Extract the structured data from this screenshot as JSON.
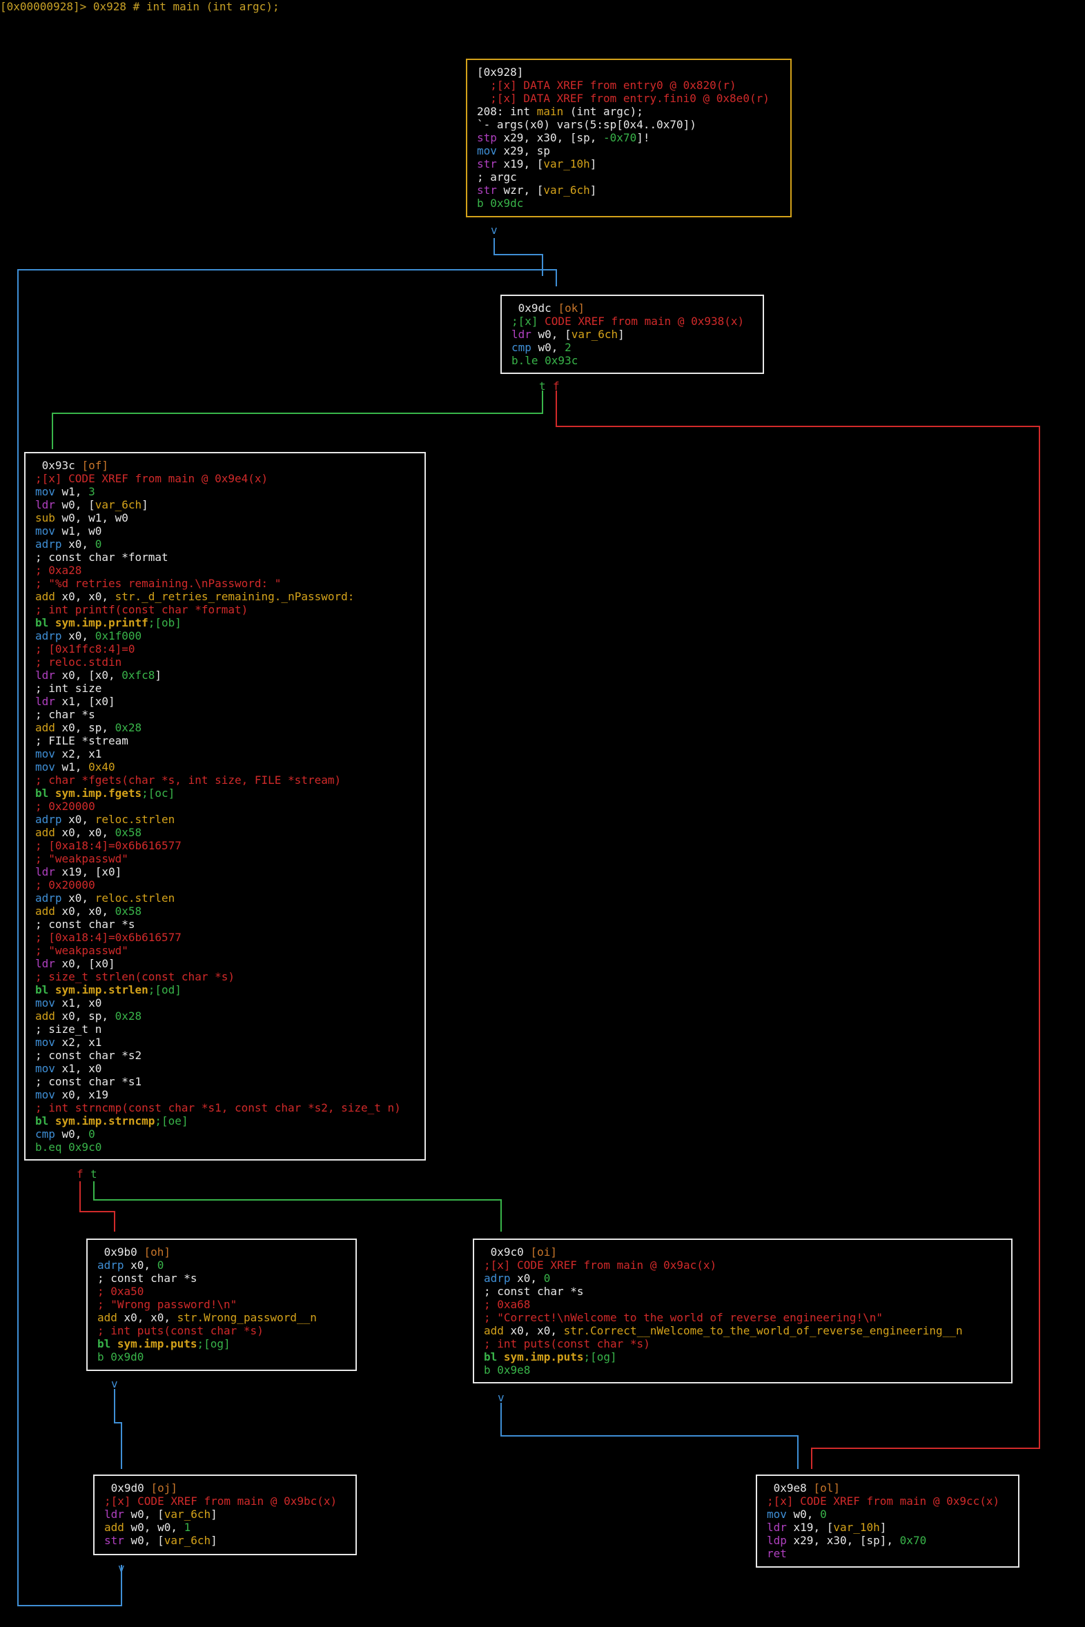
{
  "header": "[0x00000928]> 0x928 # int main (int argc);",
  "colors": {
    "white": "#e8e8e8",
    "red": "#d12a2a",
    "green": "#39b54a",
    "yellow": "#d4a21a",
    "blue": "#3f8fd6",
    "magenta": "#b040c0",
    "gray": "#bbbbbb"
  },
  "edge_labels": {
    "v": "v",
    "t": "t",
    "f": "f"
  },
  "blocks": [
    {
      "id": "b928",
      "lines": [
        [
          [
            "[0x928]",
            "w"
          ]
        ],
        [
          [
            "  ;[x] DATA XREF from entry0 @ 0x820(r)",
            "r"
          ]
        ],
        [
          [
            "  ;[x] DATA XREF from entry.fini0 @ 0x8e0(r)",
            "r"
          ]
        ],
        [
          [
            "208: int ",
            "w"
          ],
          [
            "main",
            "y"
          ],
          [
            " (int argc);",
            "w"
          ]
        ],
        [
          [
            "`- args(x0) vars(5:sp[0x4..0x70])",
            "w"
          ]
        ],
        [
          [
            "stp",
            "m"
          ],
          [
            " x29, x30, [sp, ",
            "w"
          ],
          [
            "-0x70",
            "g"
          ],
          [
            "]!",
            "w"
          ]
        ],
        [
          [
            "mov",
            "b"
          ],
          [
            " x29, sp",
            "w"
          ]
        ],
        [
          [
            "str",
            "m"
          ],
          [
            " x19, [",
            "w"
          ],
          [
            "var_10h",
            "y"
          ],
          [
            "]",
            "w"
          ]
        ],
        [
          [
            "; argc",
            "w"
          ]
        ],
        [
          [
            "str",
            "m"
          ],
          [
            " wzr, [",
            "w"
          ],
          [
            "var_6ch",
            "y"
          ],
          [
            "]",
            "w"
          ]
        ],
        [
          [
            "b 0x9dc",
            "g"
          ]
        ]
      ]
    },
    {
      "id": "b9dc",
      "lines": [
        [
          [
            " 0x9dc ",
            "w"
          ],
          [
            "[ok]",
            "o"
          ]
        ],
        [
          [
            ";[x]",
            "g"
          ],
          [
            " CODE XREF from main @ 0x938(x)",
            "r"
          ]
        ],
        [
          [
            "ldr",
            "m"
          ],
          [
            " w0, [",
            "w"
          ],
          [
            "var_6ch",
            "y"
          ],
          [
            "]",
            "w"
          ]
        ],
        [
          [
            "cmp",
            "b"
          ],
          [
            " w0, ",
            "w"
          ],
          [
            "2",
            "g"
          ]
        ],
        [
          [
            "b.le 0x93c",
            "g"
          ]
        ]
      ]
    },
    {
      "id": "b93c",
      "lines": [
        [
          [
            " 0x93c ",
            "w"
          ],
          [
            "[of]",
            "o"
          ]
        ],
        [
          [
            ";[x] CODE XREF from main @ 0x9e4(x)",
            "r"
          ]
        ],
        [
          [
            "mov",
            "b"
          ],
          [
            " w1, ",
            "w"
          ],
          [
            "3",
            "g"
          ]
        ],
        [
          [
            "ldr",
            "m"
          ],
          [
            " w0, [",
            "w"
          ],
          [
            "var_6ch",
            "y"
          ],
          [
            "]",
            "w"
          ]
        ],
        [
          [
            "sub",
            "y"
          ],
          [
            " w0, w1, w0",
            "w"
          ]
        ],
        [
          [
            "mov",
            "b"
          ],
          [
            " w1, w0",
            "w"
          ]
        ],
        [
          [
            "adrp",
            "b"
          ],
          [
            " x0, ",
            "w"
          ],
          [
            "0",
            "g"
          ]
        ],
        [
          [
            "; const char *format",
            "w"
          ]
        ],
        [
          [
            "; 0xa28",
            "r"
          ]
        ],
        [
          [
            "; \"%d retries remaining.\\nPassword: \"",
            "r"
          ]
        ],
        [
          [
            "add",
            "y"
          ],
          [
            " x0, x0, ",
            "w"
          ],
          [
            "str._d_retries_remaining._nPassword:",
            "y"
          ]
        ],
        [
          [
            "; int printf(const char *format)",
            "r"
          ]
        ],
        [
          [
            "bl ",
            "G"
          ],
          [
            "sym.imp.printf",
            "Y"
          ],
          [
            ";[ob]",
            "g"
          ]
        ],
        [
          [
            "adrp",
            "b"
          ],
          [
            " x0, ",
            "w"
          ],
          [
            "0x1f000",
            "g"
          ]
        ],
        [
          [
            "; [0x1ffc8:4]=0",
            "r"
          ]
        ],
        [
          [
            "; reloc.stdin",
            "r"
          ]
        ],
        [
          [
            "ldr",
            "m"
          ],
          [
            " x0, [x0, ",
            "w"
          ],
          [
            "0xfc8",
            "g"
          ],
          [
            "]",
            "w"
          ]
        ],
        [
          [
            "; int size",
            "w"
          ]
        ],
        [
          [
            "ldr",
            "m"
          ],
          [
            " x1, [x0]",
            "w"
          ]
        ],
        [
          [
            "; char *s",
            "w"
          ]
        ],
        [
          [
            "add",
            "y"
          ],
          [
            " x0, sp, ",
            "w"
          ],
          [
            "0x28",
            "g"
          ]
        ],
        [
          [
            "; FILE *stream",
            "w"
          ]
        ],
        [
          [
            "mov",
            "b"
          ],
          [
            " x2, x1",
            "w"
          ]
        ],
        [
          [
            "mov",
            "b"
          ],
          [
            " w1, ",
            "w"
          ],
          [
            "0x40",
            "y"
          ]
        ],
        [
          [
            "; char *fgets(char *s, int size, FILE *stream)",
            "r"
          ]
        ],
        [
          [
            "bl ",
            "G"
          ],
          [
            "sym.imp.fgets",
            "Y"
          ],
          [
            ";[oc]",
            "g"
          ]
        ],
        [
          [
            "; 0x20000",
            "r"
          ]
        ],
        [
          [
            "adrp",
            "b"
          ],
          [
            " x0, ",
            "w"
          ],
          [
            "reloc.strlen",
            "y"
          ]
        ],
        [
          [
            "add",
            "y"
          ],
          [
            " x0, x0, ",
            "w"
          ],
          [
            "0x58",
            "g"
          ]
        ],
        [
          [
            "; [0xa18:4]=0x6b616577",
            "r"
          ]
        ],
        [
          [
            "; \"weakpasswd\"",
            "r"
          ]
        ],
        [
          [
            "ldr",
            "m"
          ],
          [
            " x19, [x0]",
            "w"
          ]
        ],
        [
          [
            "; 0x20000",
            "r"
          ]
        ],
        [
          [
            "adrp",
            "b"
          ],
          [
            " x0, ",
            "w"
          ],
          [
            "reloc.strlen",
            "y"
          ]
        ],
        [
          [
            "add",
            "y"
          ],
          [
            " x0, x0, ",
            "w"
          ],
          [
            "0x58",
            "g"
          ]
        ],
        [
          [
            "; const char *s",
            "w"
          ]
        ],
        [
          [
            "; [0xa18:4]=0x6b616577",
            "r"
          ]
        ],
        [
          [
            "; \"weakpasswd\"",
            "r"
          ]
        ],
        [
          [
            "ldr",
            "m"
          ],
          [
            " x0, [x0]",
            "w"
          ]
        ],
        [
          [
            "; size_t strlen(const char *s)",
            "r"
          ]
        ],
        [
          [
            "bl ",
            "G"
          ],
          [
            "sym.imp.strlen",
            "Y"
          ],
          [
            ";[od]",
            "g"
          ]
        ],
        [
          [
            "mov",
            "b"
          ],
          [
            " x1, x0",
            "w"
          ]
        ],
        [
          [
            "add",
            "y"
          ],
          [
            " x0, sp, ",
            "w"
          ],
          [
            "0x28",
            "g"
          ]
        ],
        [
          [
            "; size_t n",
            "w"
          ]
        ],
        [
          [
            "mov",
            "b"
          ],
          [
            " x2, x1",
            "w"
          ]
        ],
        [
          [
            "; const char *s2",
            "w"
          ]
        ],
        [
          [
            "mov",
            "b"
          ],
          [
            " x1, x0",
            "w"
          ]
        ],
        [
          [
            "; const char *s1",
            "w"
          ]
        ],
        [
          [
            "mov",
            "b"
          ],
          [
            " x0, x19",
            "w"
          ]
        ],
        [
          [
            "; int strncmp(const char *s1, const char *s2, size_t n)",
            "r"
          ]
        ],
        [
          [
            "bl ",
            "G"
          ],
          [
            "sym.imp.strncmp",
            "Y"
          ],
          [
            ";[oe]",
            "g"
          ]
        ],
        [
          [
            "cmp",
            "b"
          ],
          [
            " w0, ",
            "w"
          ],
          [
            "0",
            "g"
          ]
        ],
        [
          [
            "b.eq 0x9c0",
            "g"
          ]
        ]
      ]
    },
    {
      "id": "b9b0",
      "lines": [
        [
          [
            " 0x9b0 ",
            "w"
          ],
          [
            "[oh]",
            "o"
          ]
        ],
        [
          [
            "adrp",
            "b"
          ],
          [
            " x0, ",
            "w"
          ],
          [
            "0",
            "g"
          ]
        ],
        [
          [
            "; const char *s",
            "w"
          ]
        ],
        [
          [
            "; 0xa50",
            "r"
          ]
        ],
        [
          [
            "; \"Wrong password!\\n\"",
            "r"
          ]
        ],
        [
          [
            "add",
            "y"
          ],
          [
            " x0, x0, ",
            "w"
          ],
          [
            "str.Wrong_password__n",
            "y"
          ]
        ],
        [
          [
            "; int puts(const char *s)",
            "r"
          ]
        ],
        [
          [
            "bl ",
            "G"
          ],
          [
            "sym.imp.puts",
            "Y"
          ],
          [
            ";[og]",
            "g"
          ]
        ],
        [
          [
            "b 0x9d0",
            "g"
          ]
        ]
      ]
    },
    {
      "id": "b9c0",
      "lines": [
        [
          [
            " 0x9c0 ",
            "w"
          ],
          [
            "[oi]",
            "o"
          ]
        ],
        [
          [
            ";[x] CODE XREF from main @ 0x9ac(x)",
            "r"
          ]
        ],
        [
          [
            "adrp",
            "b"
          ],
          [
            " x0, ",
            "w"
          ],
          [
            "0",
            "g"
          ]
        ],
        [
          [
            "; const char *s",
            "w"
          ]
        ],
        [
          [
            "; 0xa68",
            "r"
          ]
        ],
        [
          [
            "; \"Correct!\\nWelcome to the world of reverse engineering!\\n\"",
            "r"
          ]
        ],
        [
          [
            "add",
            "y"
          ],
          [
            " x0, x0, ",
            "w"
          ],
          [
            "str.Correct__nWelcome_to_the_world_of_reverse_engineering__n",
            "y"
          ]
        ],
        [
          [
            "; int puts(const char *s)",
            "r"
          ]
        ],
        [
          [
            "bl ",
            "G"
          ],
          [
            "sym.imp.puts",
            "Y"
          ],
          [
            ";[og]",
            "g"
          ]
        ],
        [
          [
            "b 0x9e8",
            "g"
          ]
        ]
      ]
    },
    {
      "id": "b9d0",
      "lines": [
        [
          [
            " 0x9d0 ",
            "w"
          ],
          [
            "[oj]",
            "o"
          ]
        ],
        [
          [
            ";[x] CODE XREF from main @ 0x9bc(x)",
            "r"
          ]
        ],
        [
          [
            "ldr",
            "m"
          ],
          [
            " w0, [",
            "w"
          ],
          [
            "var_6ch",
            "y"
          ],
          [
            "]",
            "w"
          ]
        ],
        [
          [
            "add",
            "y"
          ],
          [
            " w0, w0, ",
            "w"
          ],
          [
            "1",
            "g"
          ]
        ],
        [
          [
            "str",
            "m"
          ],
          [
            " w0, [",
            "w"
          ],
          [
            "var_6ch",
            "y"
          ],
          [
            "]",
            "w"
          ]
        ]
      ]
    },
    {
      "id": "b9e8",
      "lines": [
        [
          [
            " 0x9e8 ",
            "w"
          ],
          [
            "[ol]",
            "o"
          ]
        ],
        [
          [
            ";[x] CODE XREF from main @ 0x9cc(x)",
            "r"
          ]
        ],
        [
          [
            "mov",
            "b"
          ],
          [
            " w0, ",
            "w"
          ],
          [
            "0",
            "g"
          ]
        ],
        [
          [
            "ldr",
            "m"
          ],
          [
            " x19, [",
            "w"
          ],
          [
            "var_10h",
            "y"
          ],
          [
            "]",
            "w"
          ]
        ],
        [
          [
            "ldp",
            "m"
          ],
          [
            " x29, x30, [sp], ",
            "w"
          ],
          [
            "0x70",
            "g"
          ]
        ],
        [
          [
            "ret",
            "m"
          ]
        ]
      ]
    }
  ]
}
